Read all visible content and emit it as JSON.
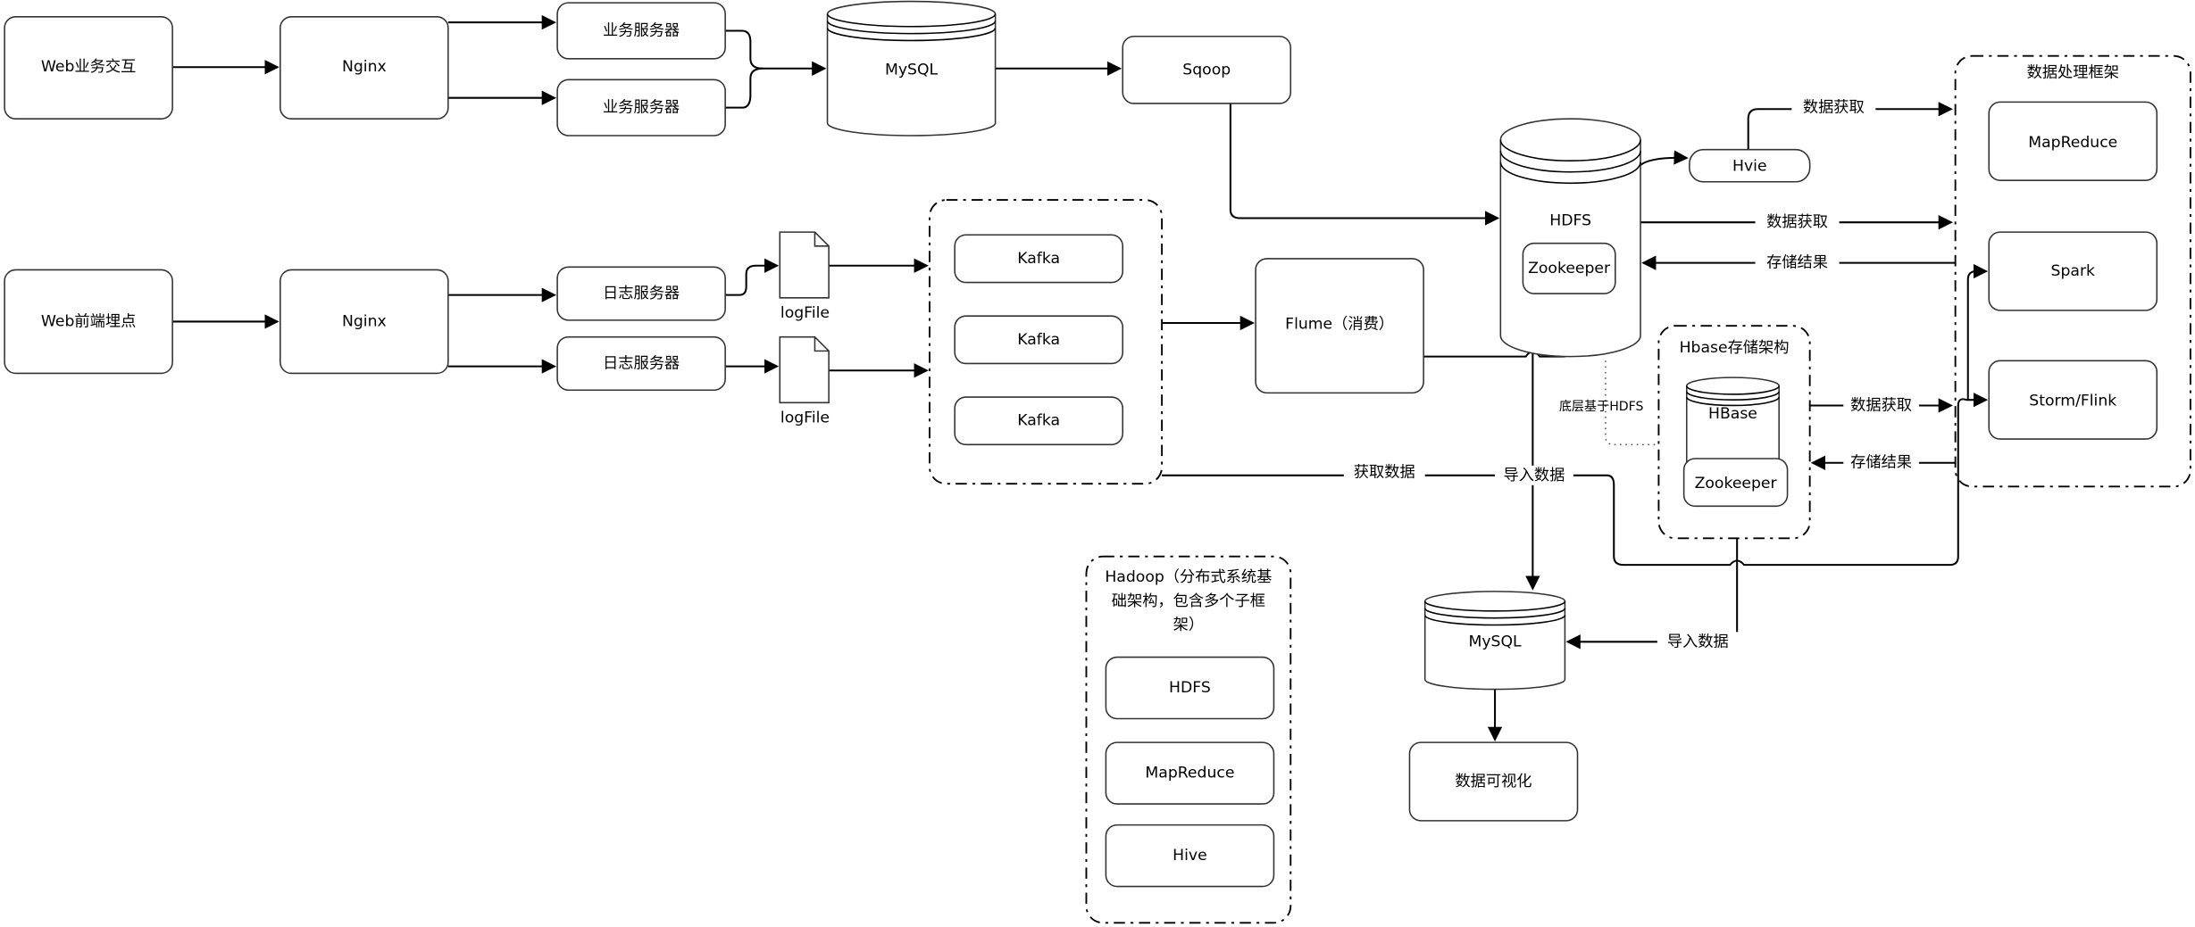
{
  "nodes": {
    "web_biz": "Web业务交互",
    "nginx1": "Nginx",
    "biz_server1": "业务服务器",
    "biz_server2": "业务服务器",
    "mysql1": "MySQL",
    "sqoop": "Sqoop",
    "web_front": "Web前端埋点",
    "nginx2": "Nginx",
    "log_server1": "日志服务器",
    "log_server2": "日志服务器",
    "logfile1": "logFile",
    "logfile2": "logFile",
    "kafka1": "Kafka",
    "kafka2": "Kafka",
    "kafka3": "Kafka",
    "flume": "Flume（消费）",
    "hdfs": "HDFS",
    "hdfs_zookeeper": "Zookeeper",
    "hvie": "Hvie",
    "processing_group": "数据处理框架",
    "mapreduce": "MapReduce",
    "spark": "Spark",
    "storm": "Storm/Flink",
    "hbase_group": "Hbase存储架构",
    "hbase": "HBase",
    "hbase_zookeeper": "Zookeeper",
    "hdfs_based": "底层基于HDFS",
    "hadoop_group_line1": "Hadoop（分布式系统基",
    "hadoop_group_line2": "础架构，包含多个子框",
    "hadoop_group_line3": "架）",
    "hadoop_hdfs": "HDFS",
    "hadoop_mapreduce": "MapReduce",
    "hadoop_hive": "Hive",
    "mysql2": "MySQL",
    "visualization": "数据可视化"
  },
  "edge_labels": {
    "hvie_fetch": "数据获取",
    "hdfs_fetch": "数据获取",
    "hdfs_store": "存储结果",
    "hbase_fetch": "数据获取",
    "hbase_store": "存储结果",
    "kafka_fetch": "获取数据",
    "import1": "导入数据",
    "import2": "导入数据"
  }
}
